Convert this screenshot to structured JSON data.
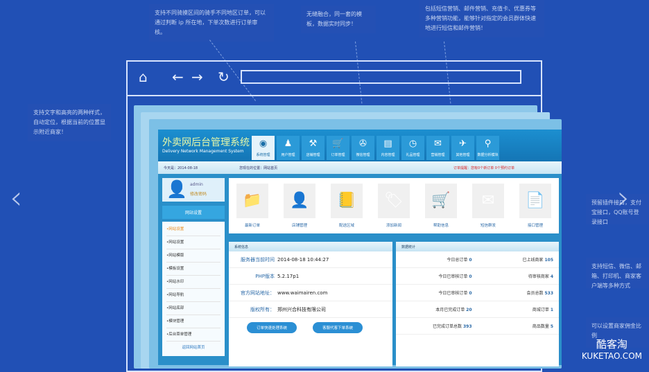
{
  "annotations": {
    "top1": "支持不同骑摸区间的骑手不同地区订单，可以通过判断 ip 所在地，下单次数进行订单审核。",
    "top2": "无缝融合，同一套的模板，数据实时同步！",
    "top3": "包括短信营销、邮件营销、充值卡、优惠券等多种营销功能，能够针对指定的会员群体快速地进行短信和邮件营销！",
    "left": "支持文字和高亮的两种样式，自动定位，根据当前的位置显示附近商家！",
    "right1": "预留插件接口，支付宝接口，QQ账号登录接口",
    "right2": "支持短信、微信、邮箱、打印机、商家客户端等多种方式",
    "right3": "可以设置商家佣金比例"
  },
  "admin": {
    "title": "外卖网后台管理系统",
    "subtitle": "Delivery Network Management System",
    "tabs": [
      "系统管理",
      "用户管理",
      "店铺管理",
      "订单管理",
      "微信管理",
      "内容管理",
      "礼品管理",
      "营销管理",
      "其他管理",
      "数据分析模块"
    ],
    "info": {
      "date": "今天是：2014-08-18",
      "location": "您现在的位置：网站首页",
      "alert": "订单提醒：您有0个新订单 0个预约订单"
    },
    "user": {
      "name": "admin",
      "change_pw": "修改密码"
    },
    "side_title": "网站设置",
    "menu": [
      "•网站设置",
      "•网站设置",
      "•网站模版",
      "•模板设置",
      "•网站水印",
      "•网站导航",
      "•网站底部",
      "•模块管理",
      "•后台菜单管理"
    ],
    "back": "返回网站首页",
    "quick": [
      "最新订单",
      "店铺管理",
      "配送区域",
      "添加新闻",
      "帮助信息",
      "短信群发",
      "接口管理"
    ],
    "sys_title": "系统信息",
    "sys": [
      {
        "k": "服务器当前时间",
        "v": "2014-08-18 10:44:27"
      },
      {
        "k": "PHP版本",
        "v": "5.2.17p1"
      },
      {
        "k": "官方网站地址：",
        "v": "www.waimairen.com"
      },
      {
        "k": "版权所有：",
        "v": "郑州兴合科技有限公司"
      }
    ],
    "buttons": [
      "订单快速处理系统",
      "客服代客下单系统"
    ],
    "stats_title": "数据统计",
    "stats": [
      {
        "a": "今日总订单",
        "av": "0",
        "b": "已上线商家",
        "bv": "105"
      },
      {
        "a": "今日已审核订单",
        "av": "0",
        "b": "待审核商家",
        "bv": "4"
      },
      {
        "a": "今日已审核订单",
        "av": "0",
        "b": "会员总数",
        "bv": "533"
      },
      {
        "a": "本月已完成订单",
        "av": "20",
        "b": "商城订单",
        "bv": "1"
      },
      {
        "a": "已完成订单总数",
        "av": "393",
        "b": "商品数量",
        "bv": "5"
      }
    ]
  },
  "watermark": {
    "cn": "酷客淘",
    "en": "KUKETAO.COM"
  }
}
